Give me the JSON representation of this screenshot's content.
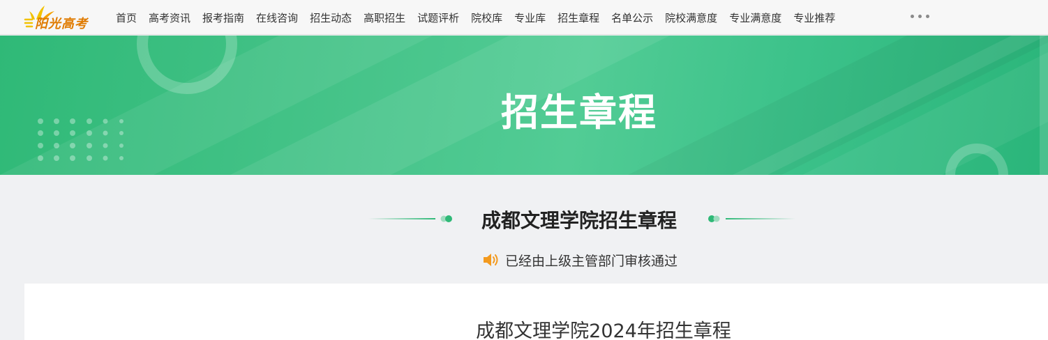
{
  "nav": {
    "logo_text": "阳光高考",
    "items": [
      "首页",
      "高考资讯",
      "报考指南",
      "在线咨询",
      "招生动态",
      "高职招生",
      "试题评析",
      "院校库",
      "专业库",
      "招生章程",
      "名单公示",
      "院校满意度",
      "专业满意度",
      "专业推荐"
    ],
    "more_icon": "more-dots-icon"
  },
  "banner": {
    "title": "招生章程"
  },
  "section": {
    "heading": "成都文理学院招生章程",
    "notice": "已经由上级主管部门审核通过",
    "notice_icon": "speaker-icon"
  },
  "document": {
    "title": "成都文理学院2024年招生章程"
  },
  "colors": {
    "brand_green": "#2fb977",
    "logo_orange": "#e07b00",
    "speaker_orange": "#f39a1e"
  }
}
